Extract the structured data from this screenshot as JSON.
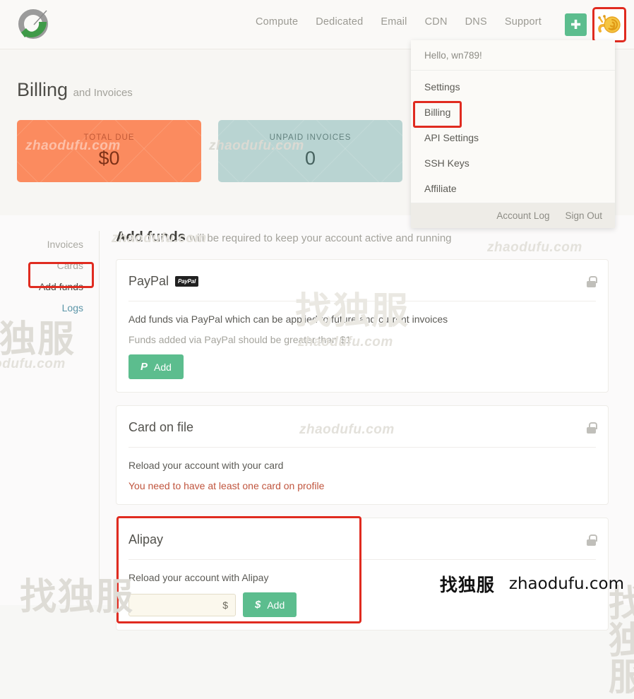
{
  "brand": {
    "logo_icon": "snail-swoosh-logo"
  },
  "nav": {
    "items": [
      {
        "label": "Compute"
      },
      {
        "label": "Dedicated"
      },
      {
        "label": "Email"
      },
      {
        "label": "CDN"
      },
      {
        "label": "DNS"
      },
      {
        "label": "Support"
      }
    ],
    "add_icon": "plus-icon",
    "avatar_icon": "snail-avatar-icon"
  },
  "dropdown": {
    "greeting": "Hello, wn789!",
    "items": [
      {
        "label": "Settings"
      },
      {
        "label": "Billing"
      },
      {
        "label": "API Settings"
      },
      {
        "label": "SSH Keys"
      },
      {
        "label": "Affiliate"
      }
    ],
    "footer": [
      {
        "label": "Account Log"
      },
      {
        "label": "Sign Out"
      }
    ]
  },
  "billing": {
    "title": "Billing",
    "subtitle": "and Invoices",
    "stats": [
      {
        "label": "TOTAL DUE",
        "value": "$0",
        "color": "#fb8b5f"
      },
      {
        "label": "UNPAID INVOICES",
        "value": "0",
        "color": "#b9d4d2"
      }
    ]
  },
  "sidebar": {
    "items": [
      {
        "label": "Invoices"
      },
      {
        "label": "Cards"
      },
      {
        "label": "Add funds"
      },
      {
        "label": "Logs"
      }
    ]
  },
  "content": {
    "title": "Add funds",
    "subtitle": "will be required to keep your account active and running",
    "cards": [
      {
        "title": "PayPal",
        "badge": "PayPal",
        "lock_icon": "lock-icon",
        "line1": "Add funds via PayPal which can be applied to future and current invoices",
        "line2": "Funds added via PayPal should be greater than $1",
        "button": {
          "glyph": "P",
          "label": "Add"
        }
      },
      {
        "title": "Card on file",
        "lock_icon": "lock-icon",
        "line1": "Reload your account with your card",
        "warning": "You need to have at least one card on profile"
      },
      {
        "title": "Alipay",
        "lock_icon": "lock-icon",
        "line1": "Reload your account with Alipay",
        "amount_value": "",
        "amount_placeholder": "",
        "currency_symbol": "$",
        "button": {
          "glyph": "$",
          "label": "Add"
        }
      }
    ]
  },
  "watermarks": {
    "cn": "找独服",
    "url": "zhaodufu.com"
  },
  "highlight_color": "#e02b20"
}
